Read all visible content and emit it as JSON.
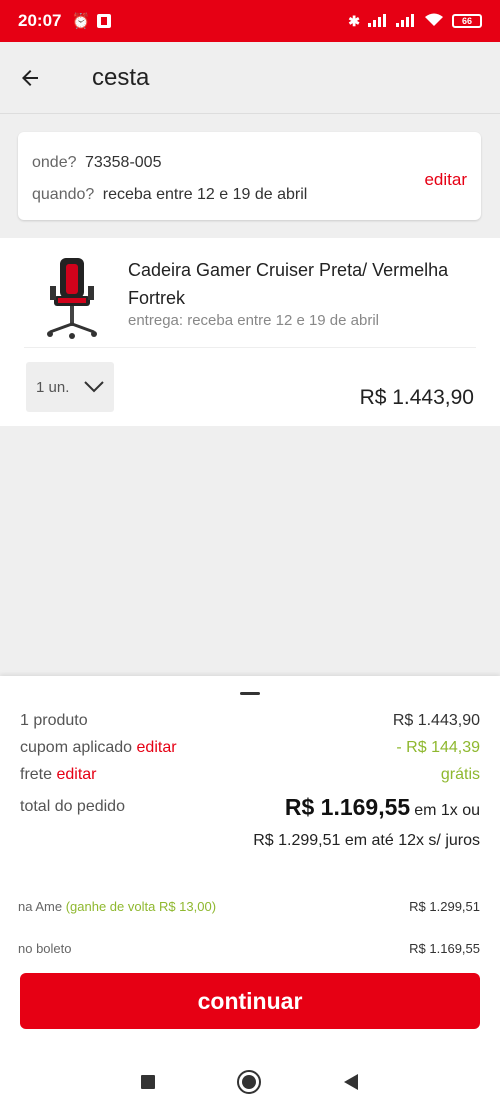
{
  "status_bar": {
    "time": "20:07",
    "battery": "66"
  },
  "header": {
    "title": "cesta"
  },
  "delivery": {
    "where_label": "onde?",
    "where_value": "73358-005",
    "when_label": "quando?",
    "when_value": "receba entre 12 e 19 de abril",
    "edit_label": "editar"
  },
  "product": {
    "name": "Cadeira Gamer Cruiser Preta/ Vermelha Fortrek",
    "delivery_text": "entrega: receba entre 12 e 19 de abril",
    "quantity": "1 un.",
    "price": "R$ 1.443,90"
  },
  "summary": {
    "products_label": "1 produto",
    "products_value": "R$ 1.443,90",
    "coupon_label": "cupom aplicado",
    "coupon_edit": "editar",
    "coupon_value": "- R$ 144,39",
    "shipping_label": "frete",
    "shipping_edit": "editar",
    "shipping_value": "grátis",
    "total_label": "total do pedido",
    "total_value": "R$ 1.169,55",
    "total_suffix": "em 1x ou",
    "installments": "R$ 1.299,51 em até 12x s/ juros",
    "ame_label": "na Ame",
    "ame_cashback": "(ganhe de volta R$ 13,00)",
    "ame_value": "R$ 1.299,51",
    "boleto_label": "no boleto",
    "boleto_value": "R$ 1.169,55",
    "continue_label": "continuar"
  },
  "colors": {
    "brand": "#e60014",
    "discount": "#8fb82f"
  }
}
